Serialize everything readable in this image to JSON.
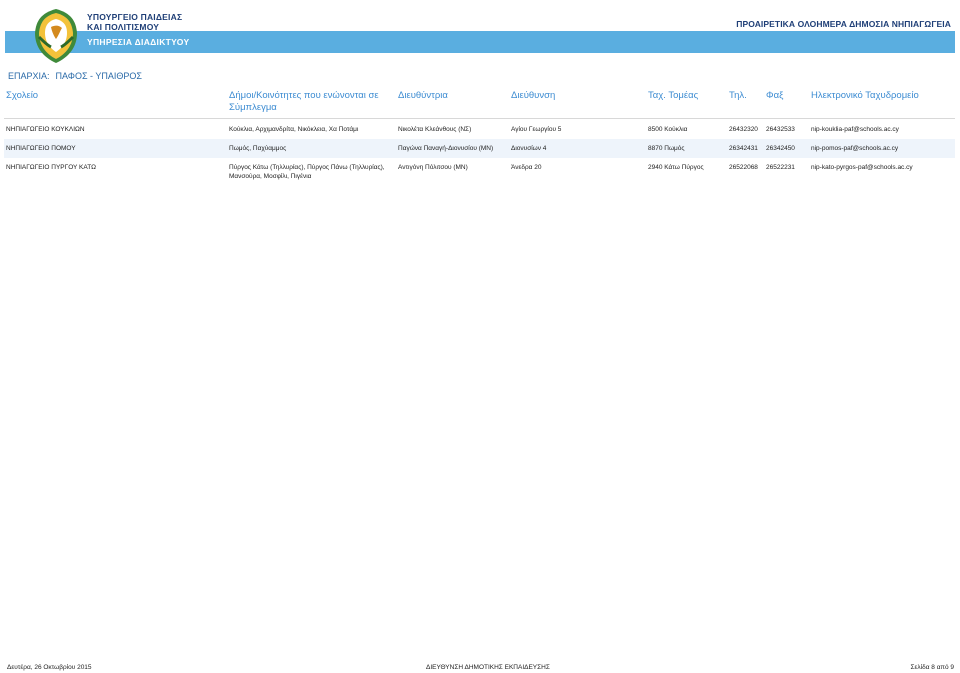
{
  "header": {
    "ministry_line1": "ΥΠΟΥΡΓΕΙΟ ΠΑΙΔΕΙΑΣ",
    "ministry_line2": "ΚΑΙ ΠΟΛΙΤΙΣΜΟΥ",
    "service": "ΥΠΗΡΕΣΙΑ ΔΙΑΔΙΚΤΥΟΥ",
    "program_title": "ΠΡΟΑΙΡΕΤΙΚΑ ΟΛΟΗΜΕΡΑ ΔΗΜΟΣΙΑ ΝΗΠΙΑΓΩΓΕΙΑ",
    "band_color": "#5aaee0",
    "title_color": "#1f3f77"
  },
  "filter": {
    "label": "ΕΠΑΡΧΙΑ:",
    "value": "ΠΑΦΟΣ - ΥΠΑΙΘΡΟΣ"
  },
  "table": {
    "headers": [
      "Σχολείο",
      "Δήμοι/Κοινότητες που ενώνονται σε Σύμπλεγμα",
      "Διευθύντρια",
      "Διεύθυνση",
      "Ταχ. Τομέας",
      "Τηλ.",
      "Φαξ",
      "Ηλεκτρονικό Ταχυδρομείο"
    ],
    "rows": [
      [
        "ΝΗΠΙΑΓΩΓΕΙΟ ΚΟΥΚΛΙΩΝ",
        "Κούκλια, Αρχιμανδρίτα, Νικόκλεια, Χα Ποτάμι",
        "Νικολέτα Κλεάνθους (ΝΣ)",
        "Αγίου Γεωργίου 5",
        "8500 Κούκλια",
        "26432320",
        "26432533",
        "nip-kouklia-paf@schools.ac.cy"
      ],
      [
        "ΝΗΠΙΑΓΩΓΕΙΟ ΠΟΜΟΥ",
        "Πωμός, Παχύαμμος",
        "Παγώνα Παναγή-Διονυσίου (ΜΝ)",
        "Διονυσίων 4",
        "8870 Πωμός",
        "26342431",
        "26342450",
        "nip-pomos-paf@schools.ac.cy"
      ],
      [
        "ΝΗΠΙΑΓΩΓΕΙΟ ΠΥΡΓΟΥ ΚΑΤΩ",
        "Πύργος Κάτω (Τηλλυρίας), Πύργος Πάνω (Τηλλυρίας), Μανσούρα, Μοσφίλι, Πιγένια",
        "Αντιγόνη Πόλιτσου (ΜΝ)",
        "Άνεδρα 20",
        "2940 Κάτω Πύργος",
        "26522068",
        "26522231",
        "nip-kato-pyrgos-paf@schools.ac.cy"
      ]
    ]
  },
  "footer": {
    "date": "Δευτέρα, 26 Οκτωβρίου 2015",
    "department": "ΔΙΕΥΘΥΝΣΗ ΔΗΜΟΤΙΚΗΣ ΕΚΠΑΙΔΕΥΣΗΣ",
    "page": "Σελίδα 8 από 9"
  }
}
